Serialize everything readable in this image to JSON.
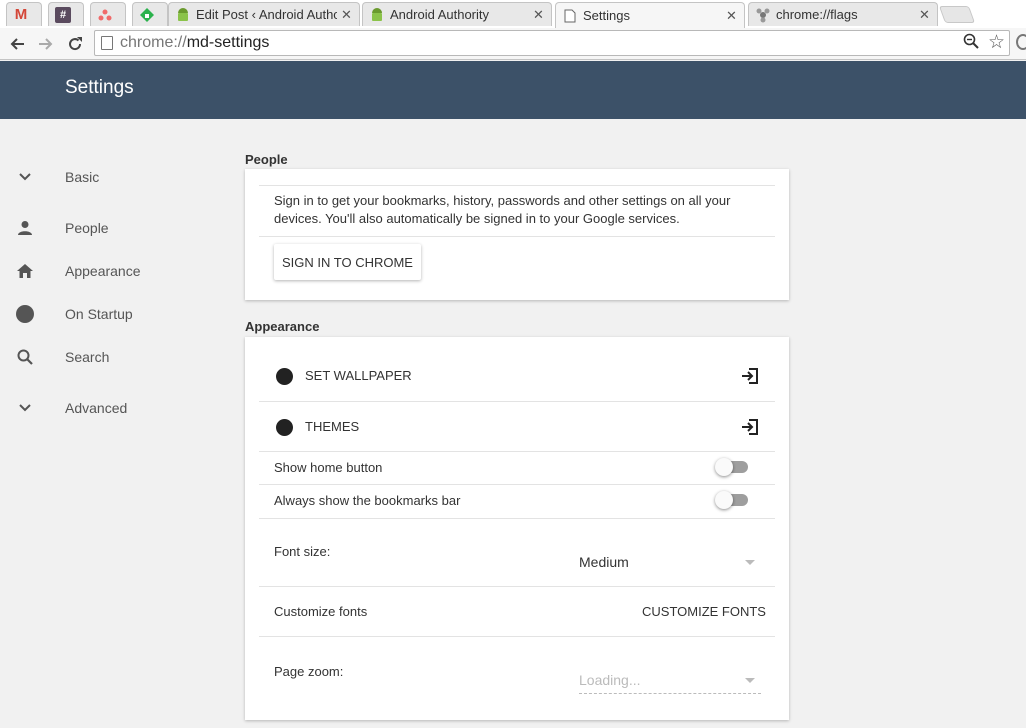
{
  "tabs": [
    {
      "title": "",
      "icon": "gmail-icon"
    },
    {
      "title": "",
      "icon": "slack-icon"
    },
    {
      "title": "",
      "icon": "asana-icon"
    },
    {
      "title": "",
      "icon": "feedly-icon"
    },
    {
      "title": "Edit Post ‹ Android Author",
      "icon": "android-icon"
    },
    {
      "title": "Android Authority",
      "icon": "android-icon"
    },
    {
      "title": "Settings",
      "icon": "page-icon",
      "active": true
    },
    {
      "title": "chrome://flags",
      "icon": "flags-icon"
    }
  ],
  "toolbar": {
    "url_scheme": "chrome://",
    "url_path": "md-settings"
  },
  "header": {
    "title": "Settings"
  },
  "menu": {
    "basic": "Basic",
    "people": "People",
    "appearance": "Appearance",
    "on_startup": "On Startup",
    "search": "Search",
    "advanced": "Advanced"
  },
  "people": {
    "title": "People",
    "text_line1": "Sign in to get your bookmarks, history, passwords and other settings on all your",
    "text_line2": "devices. You'll also automatically be signed in to your Google services.",
    "sign_in_button": "SIGN IN TO CHROME"
  },
  "appearance": {
    "title": "Appearance",
    "set_wallpaper": "SET WALLPAPER",
    "themes": "THEMES",
    "show_home_button": "Show home button",
    "show_home_button_on": false,
    "bookmarks_bar": "Always show the bookmarks bar",
    "bookmarks_bar_on": false,
    "font_size_label": "Font size:",
    "font_size_value": "Medium",
    "customize_fonts_label": "Customize fonts",
    "customize_fonts_button": "CUSTOMIZE FONTS",
    "page_zoom_label": "Page zoom:",
    "page_zoom_value": "Loading..."
  },
  "colors": {
    "header_bg": "#3c5168",
    "page_bg": "#f1f1f1",
    "gmail_red": "#d44638",
    "feedly_green": "#2bb24c",
    "asana_coral": "#f06a6a",
    "android_green": "#8bc34a"
  }
}
